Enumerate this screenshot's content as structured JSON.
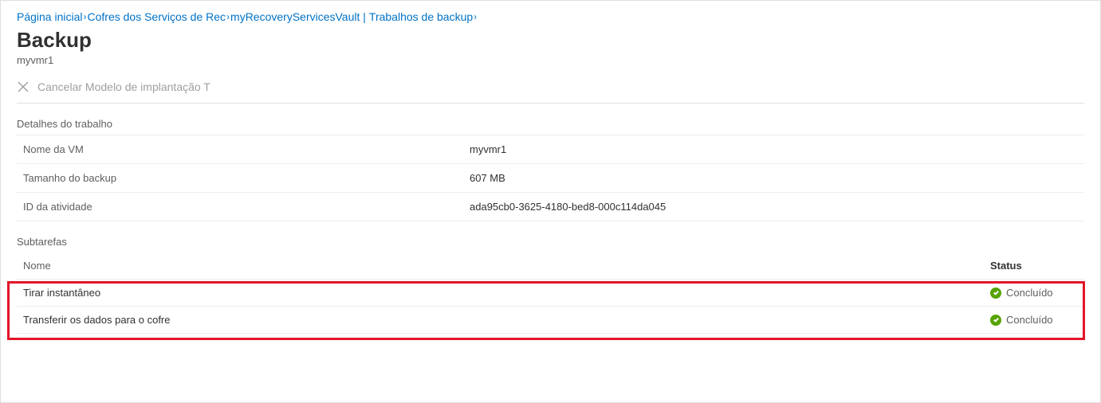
{
  "breadcrumb": {
    "items": [
      {
        "label": "Página inicial"
      },
      {
        "label": "Cofres dos Serviços de Rec"
      },
      {
        "label": "myRecoveryServicesVault |"
      },
      {
        "label": "Trabalhos de backup"
      }
    ]
  },
  "header": {
    "title": "Backup",
    "subtitle": "myvmr1"
  },
  "toolbar": {
    "cancel_label": "Cancelar Modelo de implantação T"
  },
  "sections": {
    "details_label": "Detalhes do trabalho",
    "subtasks_label": "Subtarefas"
  },
  "details": {
    "rows": [
      {
        "label": "Nome da VM",
        "value": "myvmr1"
      },
      {
        "label": "Tamanho do backup",
        "value": "607 MB"
      },
      {
        "label": "ID da atividade",
        "value": "ada95cb0-3625-4180-bed8-000c114da045"
      }
    ]
  },
  "subtasks": {
    "columns": {
      "name": "Nome",
      "status": "Status"
    },
    "rows": [
      {
        "name": "Tirar instantâneo",
        "status": "Concluído"
      },
      {
        "name": "Transferir os dados para o cofre",
        "status": "Concluído"
      }
    ]
  },
  "status_color": "#57a300"
}
